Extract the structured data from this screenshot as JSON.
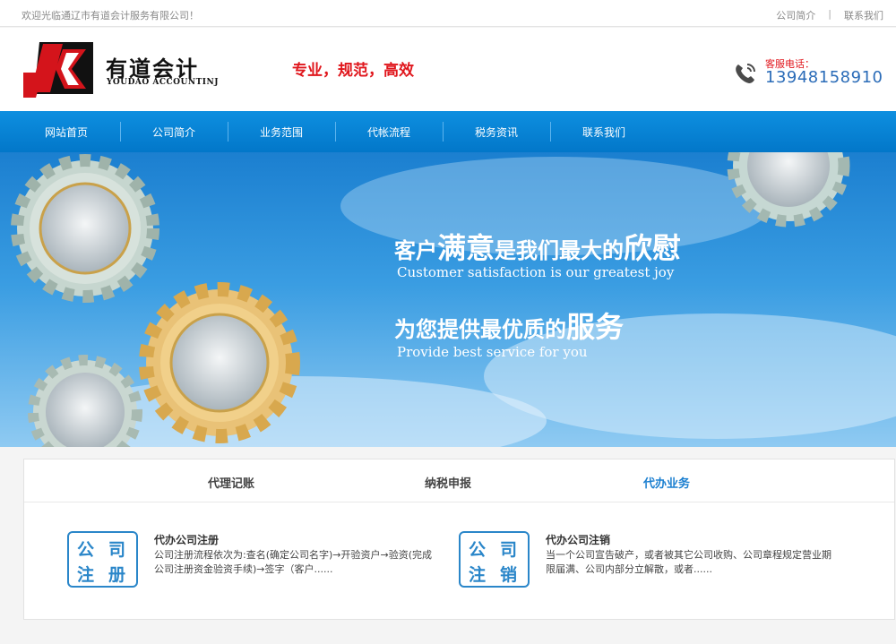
{
  "topbar": {
    "welcome": "欢迎光临通辽市有道会计服务有限公司！",
    "links": [
      "公司简介",
      "联系我们"
    ],
    "separator": "|"
  },
  "header": {
    "logo_cn": "有道会计",
    "logo_en": "YOUDAO ACCOUNTINJ",
    "slogan": "专业，规范，高效",
    "phone_label": "客服电话：",
    "phone_number": "13948158910"
  },
  "nav": {
    "items": [
      "网站首页",
      "公司简介",
      "业务范围",
      "代帐流程",
      "税务资讯",
      "联系我们"
    ]
  },
  "banner": {
    "line1_a": "客户",
    "line1_b": "满意",
    "line1_c": "是我们最大的",
    "line1_d": "欣慰",
    "line1_en": "Customer satisfaction is our greatest joy",
    "line2_a": "为您提供最优质的",
    "line2_b": "服务",
    "line2_en": "Provide best service for you"
  },
  "services": {
    "tabs": [
      "代理记账",
      "纳税申报",
      "代办业务"
    ],
    "active_tab": "代办业务",
    "items": [
      {
        "badge": [
          "公",
          "司",
          "注",
          "册"
        ],
        "title": "代办公司注册",
        "desc": "公司注册流程依次为:查名(确定公司名字)→开验资户→验资(完成公司注册资金验资手续)→签字（客户......"
      },
      {
        "badge": [
          "公",
          "司",
          "注",
          "销"
        ],
        "title": "代办公司注销",
        "desc": "当一个公司宣告破产，或者被其它公司收购、公司章程规定营业期限届满、公司内部分立解散，或者......"
      }
    ]
  },
  "colors": {
    "brand_blue": "#0277c9",
    "accent_red": "#e0161c",
    "phone_blue": "#2b6cb8"
  }
}
